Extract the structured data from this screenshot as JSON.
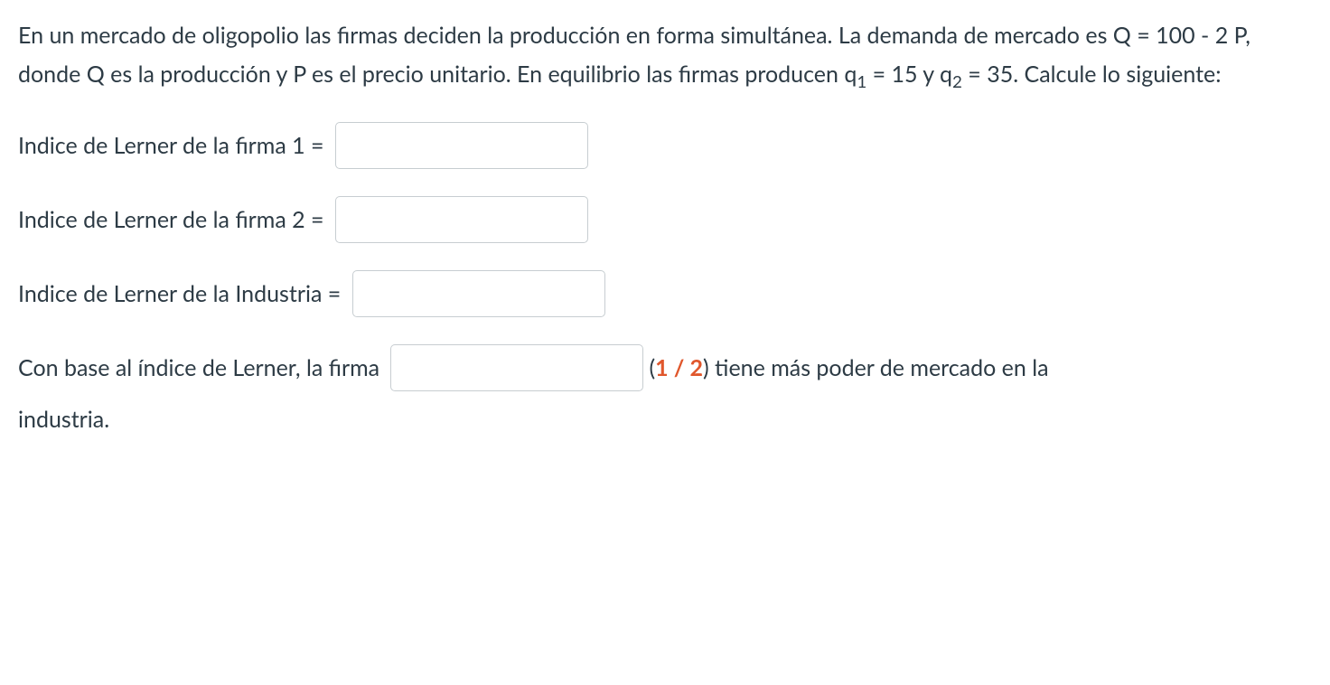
{
  "problem": {
    "intro_pre": "En un mercado de oligopolio las firmas deciden la producción en forma simultánea. La demanda de mercado es Q = 100 - 2 P, donde Q es la producción y P es el precio unitario. En equilibrio las firmas producen q",
    "sub1": "1",
    "mid1": " = 15 y q",
    "sub2": "2",
    "tail": " = 35. Calcule lo siguiente:"
  },
  "q1": {
    "label": "Indice de Lerner de la firma 1 = ",
    "value": ""
  },
  "q2": {
    "label": "Indice de Lerner de la firma 2 = ",
    "value": ""
  },
  "q3": {
    "label": "Indice de Lerner de la Industria = ",
    "value": ""
  },
  "q4": {
    "pre": "Con base al índice de Lerner, la firma ",
    "value": "",
    "hint": "1 / 2",
    "post_open": " (",
    "post_close": ") tiene más poder de mercado en la",
    "line2": "industria."
  }
}
